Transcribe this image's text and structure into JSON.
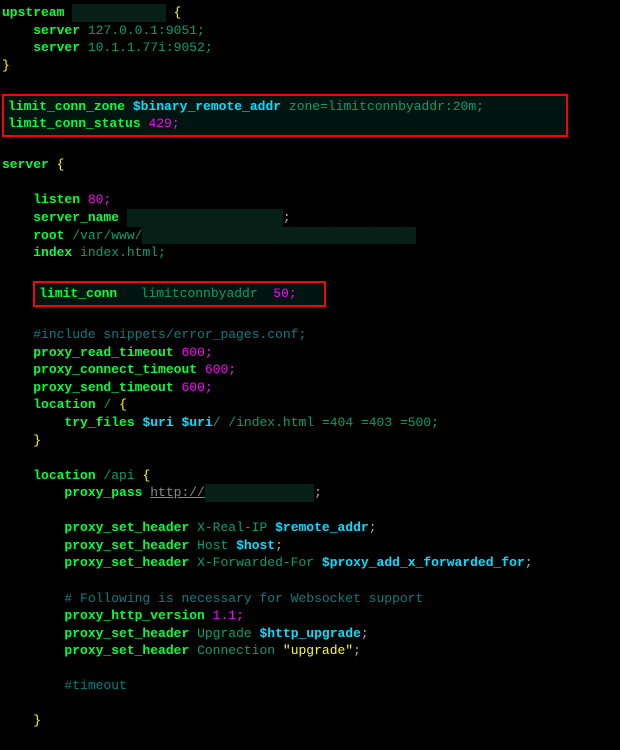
{
  "lines": {
    "upstream_kw": "upstream",
    "upstream_name": "████████████",
    "server1_kw": "server",
    "server1_val": "127.0.0.1:9051;",
    "server2_kw": "server",
    "server2_val": "10.1.1.77i:9052;",
    "lcz_kw": "limit_conn_zone",
    "lcz_var": "$binary_remote_addr",
    "lcz_opts": "zone=limitconnbyaddr:20m;",
    "lcs_kw": "limit_conn_status",
    "lcs_val": "429;",
    "server_kw": "server",
    "listen_kw": "listen",
    "listen_val": "80;",
    "sname_kw": "server_name",
    "sname_val": "████████████████████",
    "root_kw": "root",
    "root_val": "/var/www/",
    "root_red": "███████████████████████████████████",
    "index_kw": "index",
    "index_val": "index.html;",
    "lc_kw": "limit_conn",
    "lc_zone": "limitconnbyaddr",
    "lc_n": "50;",
    "inc_cmt": "#include snippets/error_pages.conf;",
    "prt_kw": "proxy_read_timeout",
    "prt_val": "600;",
    "pct_kw": "proxy_connect_timeout",
    "pct_val": "600;",
    "pst_kw": "proxy_send_timeout",
    "pst_val": "600;",
    "loc1_kw": "location",
    "loc1_path": "/",
    "tf_kw": "try_files",
    "tf_var1": "$uri",
    "tf_var2": "$uri",
    "tf_rest": "/ /index.html =404 =403 =500;",
    "loc2_kw": "location",
    "loc2_path": "/api",
    "pp_kw": "proxy_pass",
    "pp_proto": "http://",
    "pp_host": "██████████████",
    "psh_kw": "proxy_set_header",
    "psh1_name": "X-Real-IP",
    "psh1_var": "$remote_addr",
    "psh2_name": "Host",
    "psh2_var": "$host",
    "psh3_name": "X-Forwarded-For",
    "psh3_var": "$proxy_add_x_forwarded_for",
    "ws_cmt": "# Following is necessary for Websocket support",
    "phv_kw": "proxy_http_version",
    "phv_val": "1.1;",
    "psh4_name": "Upgrade",
    "psh4_var": "$http_upgrade",
    "psh5_name": "Connection",
    "psh5_str": "\"upgrade\"",
    "to_cmt": "#timeout"
  }
}
